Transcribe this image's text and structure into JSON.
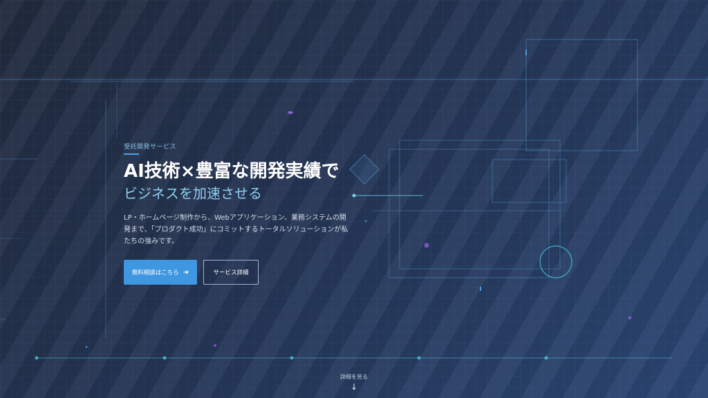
{
  "hero": {
    "eyebrow": "受託開発サービス",
    "title_line1": "AI技術×豊富な開発実績で",
    "title_line2": "ビジネスを加速させる",
    "description": "LP・ホームページ制作から、Webアプリケーション、業務システムの開発まで、「プロダクト成功」にコミットするトータルソリューションが私たちの強みです。",
    "primary_button": "無料相談はこちら",
    "secondary_button": "サービス詳細"
  },
  "scroll_hint": {
    "label": "詳細を見る"
  },
  "colors": {
    "accent": "#3f97e2",
    "highlight": "#8fcff0",
    "background": "#243453"
  },
  "icons": {
    "primary_button": "arrow-right-icon",
    "scroll_hint": "arrow-down-icon"
  }
}
